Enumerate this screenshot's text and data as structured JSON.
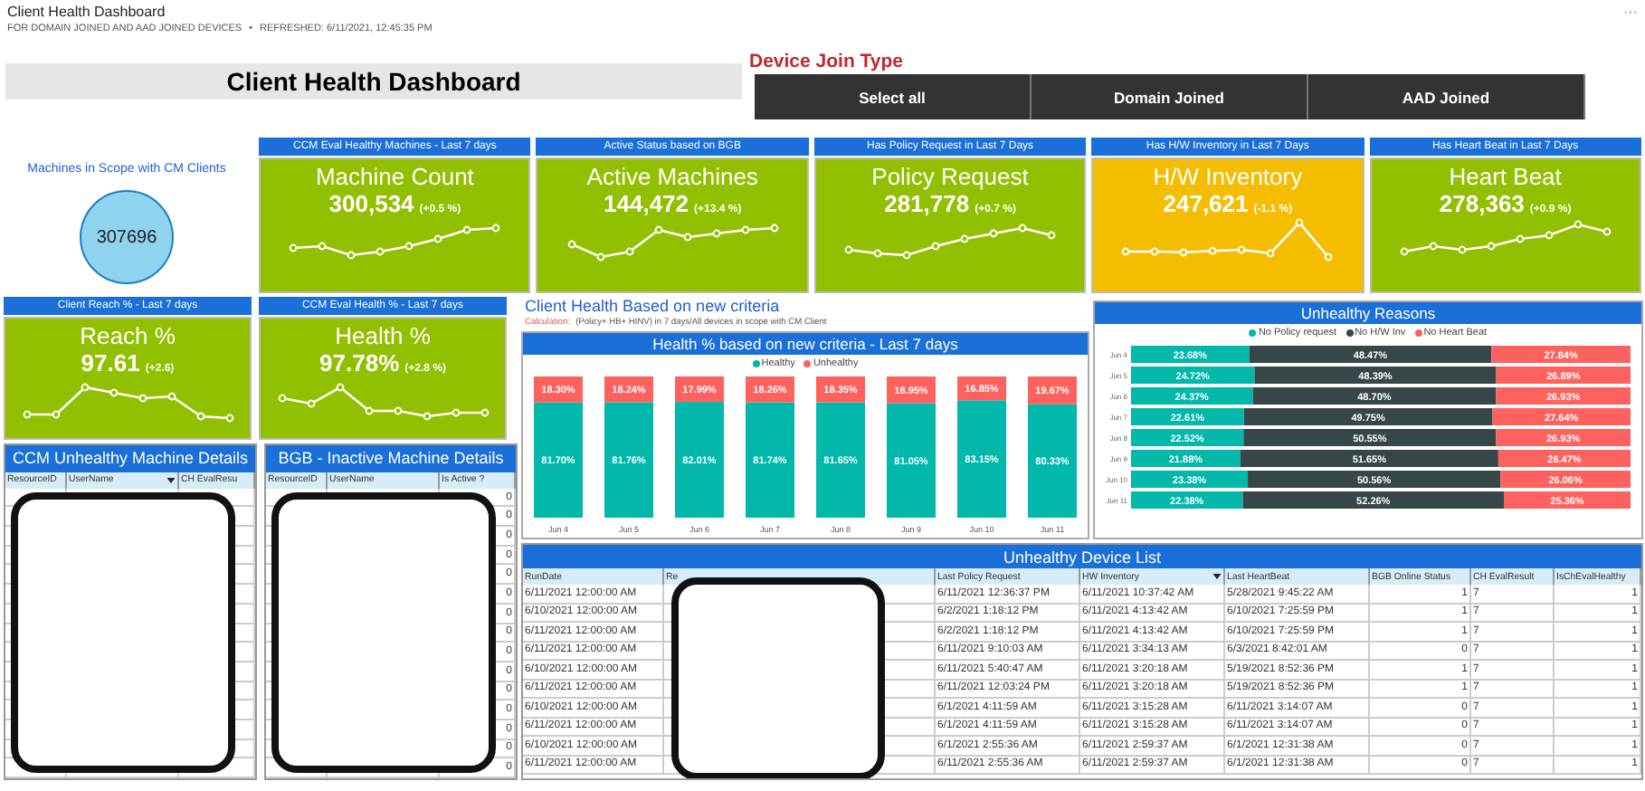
{
  "header": {
    "title": "Client Health Dashboard",
    "subtitle": "FOR DOMAIN JOINED AND AAD JOINED DEVICES",
    "separator": "•",
    "refreshed": "REFRESHED: 6/11/2021, 12:45:35 PM",
    "more": "···"
  },
  "banner": {
    "title": "Client Health Dashboard"
  },
  "join_type": {
    "label": "Device Join Type",
    "buttons": [
      {
        "label": "Select all",
        "selected": false
      },
      {
        "label": "Domain Joined",
        "selected": false
      },
      {
        "label": "AAD Joined",
        "selected": false
      }
    ]
  },
  "scope": {
    "label": "Machines in Scope with CM Clients",
    "count": "307696"
  },
  "kpi_cards": [
    {
      "header": "CCM Eval Healthy Machines - Last 7 days",
      "title": "Machine Count",
      "value": "300,534",
      "delta": "(+0.5 %)",
      "color": "#92c000"
    },
    {
      "header": "Active Status based on BGB",
      "title": "Active Machines",
      "value": "144,472",
      "delta": "(+13.4 %)",
      "color": "#92c000"
    },
    {
      "header": "Has Policy Request in Last 7 Days",
      "title": "Policy Request",
      "value": "281,778",
      "delta": "(+0.7 %)",
      "color": "#92c000"
    },
    {
      "header": "Has H/W Inventory in Last 7 Days",
      "title": "H/W Inventory",
      "value": "247,621",
      "delta": "(-1.1 %)",
      "color": "#f5bd00"
    },
    {
      "header": "Has Heart Beat in Last 7 Days",
      "title": "Heart Beat",
      "value": "278,363",
      "delta": "(+0.9 %)",
      "color": "#92c000"
    }
  ],
  "small_cards": [
    {
      "header": "Client Reach %  - Last 7 days",
      "title": "Reach %",
      "value": "97.61",
      "delta": "(+2.6)",
      "color": "#92c000"
    },
    {
      "header": "CCM Eval Health %  - Last 7 days",
      "title": "Health %",
      "value": "97.78%",
      "delta": "(+2.8 %)",
      "color": "#92c000"
    }
  ],
  "criteria": {
    "title": "Client Health Based on new criteria",
    "calc_label": "Calculation:",
    "calc_text": "(Policy+ HB+ HINV) in 7 days/All devices in scope with CM Client",
    "chart_data": {
      "type": "bar",
      "title": "Health % based on new criteria - Last 7 days",
      "stacked": true,
      "data_labels": true,
      "categories": [
        "Jun 4",
        "Jun 5",
        "Jun 6",
        "Jun 7",
        "Jun 8",
        "Jun 9",
        "Jun 10",
        "Jun 11"
      ],
      "series": [
        {
          "name": "Healthy",
          "color": "#01b8aa",
          "values": [
            81.7,
            81.76,
            82.01,
            81.74,
            81.65,
            81.05,
            83.15,
            80.33
          ],
          "value_labels": [
            "81.70%",
            "81.76%",
            "82.01%",
            "81.74%",
            "81.65%",
            "81.05%",
            "83.15%",
            "80.33%"
          ]
        },
        {
          "name": "Unhealthy",
          "color": "#fd625e",
          "values": [
            18.3,
            18.24,
            17.99,
            18.26,
            18.35,
            18.95,
            16.85,
            19.67
          ],
          "value_labels": [
            "18.30%",
            "18.24%",
            "17.99%",
            "18.26%",
            "18.35%",
            "18.95%",
            "16.85%",
            "19.67%"
          ]
        }
      ]
    }
  },
  "reasons": {
    "chart_data": {
      "type": "bar",
      "orientation": "horizontal",
      "title": "Unhealthy Reasons",
      "stacked": true,
      "data_labels": true,
      "xlim": [
        0,
        100
      ],
      "categories": [
        "Jun 4",
        "Jun 5",
        "Jun 6",
        "Jun 7",
        "Jun 8",
        "Jun 9",
        "Jun 10",
        "Jun 11"
      ],
      "series": [
        {
          "name": "No Policy request",
          "color": "#01b8aa",
          "values": [
            23.68,
            24.72,
            24.37,
            22.61,
            22.52,
            21.88,
            23.38,
            22.38
          ],
          "value_labels": [
            "23.68%",
            "24.72%",
            "24.37%",
            "22.61%",
            "22.52%",
            "21.88%",
            "23.38%",
            "22.38%"
          ]
        },
        {
          "name": "No H/W Inv",
          "color": "#374649",
          "values": [
            48.47,
            48.39,
            48.7,
            49.75,
            50.55,
            51.65,
            50.56,
            52.26
          ],
          "value_labels": [
            "48.47%",
            "48.39%",
            "48.70%",
            "49.75%",
            "50.55%",
            "51.65%",
            "50.56%",
            "52.26%"
          ]
        },
        {
          "name": "No Heart Beat",
          "color": "#fd625e",
          "values": [
            27.84,
            26.89,
            26.93,
            27.64,
            26.93,
            26.47,
            26.06,
            25.36
          ],
          "value_labels": [
            "27.84%",
            "26.89%",
            "26.93%",
            "27.64%",
            "26.93%",
            "26.47%",
            "26.06%",
            "25.36%"
          ]
        }
      ]
    }
  },
  "ccm_table": {
    "title": "CCM Unhealthy Machine Details",
    "redacted": true,
    "columns": [
      {
        "label": "ResourceID",
        "sorted": false
      },
      {
        "label": "UserName",
        "sorted": true
      },
      {
        "label": "CH EvalResu",
        "sorted": false
      }
    ],
    "rows": [
      [],
      [],
      [],
      [],
      [],
      [],
      [],
      [],
      [],
      [],
      [],
      [],
      [],
      [],
      []
    ]
  },
  "bgb_table": {
    "title": "BGB - Inactive Machine Details",
    "redacted": true,
    "columns": [
      {
        "label": "ResourceID",
        "sorted": false
      },
      {
        "label": "UserName",
        "sorted": false
      },
      {
        "label": "Is Active ?",
        "sorted": false
      }
    ],
    "rows": [
      [
        "0"
      ],
      [
        "0"
      ],
      [
        "0"
      ],
      [
        "0"
      ],
      [
        "0"
      ],
      [
        "0"
      ],
      [
        "0"
      ],
      [
        "0"
      ],
      [
        "0"
      ],
      [
        "0"
      ],
      [
        "0"
      ],
      [
        "0"
      ],
      [
        "0"
      ],
      [
        "0"
      ],
      [
        "0"
      ]
    ]
  },
  "device_list": {
    "title": "Unhealthy Device List",
    "redacted": true,
    "columns": [
      {
        "label": "RunDate",
        "sorted": false
      },
      {
        "label": "Re",
        "sorted": false
      },
      {
        "label": "Last Policy Request",
        "sorted": false
      },
      {
        "label": "HW Inventory",
        "sorted": true
      },
      {
        "label": "Last HeartBeat",
        "sorted": false
      },
      {
        "label": "BGB Online Status",
        "sorted": false
      },
      {
        "label": "CH EvalResult",
        "sorted": false
      },
      {
        "label": "IsChEvalHealthy",
        "sorted": false
      }
    ],
    "rows": [
      [
        "6/11/2021 12:00:00 AM",
        "",
        "6/11/2021 12:36:37 PM",
        "6/11/2021 10:37:42 AM",
        "5/28/2021 9:45:22 AM",
        "1",
        "7",
        "1"
      ],
      [
        "6/10/2021 12:00:00 AM",
        "",
        "6/2/2021 1:18:12 PM",
        "6/11/2021 4:13:42 AM",
        "6/10/2021 7:25:59 PM",
        "1",
        "7",
        "1"
      ],
      [
        "6/11/2021 12:00:00 AM",
        "",
        "6/2/2021 1:18:12 PM",
        "6/11/2021 4:13:42 AM",
        "6/10/2021 7:25:59 PM",
        "1",
        "7",
        "1"
      ],
      [
        "6/11/2021 12:00:00 AM",
        "",
        "6/11/2021 9:10:03 AM",
        "6/11/2021 3:34:13 AM",
        "6/3/2021 8:42:01 AM",
        "0",
        "7",
        "1"
      ],
      [
        "6/10/2021 12:00:00 AM",
        "",
        "6/11/2021 5:40:47 AM",
        "6/11/2021 3:20:18 AM",
        "5/19/2021 8:52:36 PM",
        "1",
        "7",
        "1"
      ],
      [
        "6/11/2021 12:00:00 AM",
        "",
        "6/11/2021 12:03:24 PM",
        "6/11/2021 3:20:18 AM",
        "5/19/2021 8:52:36 PM",
        "1",
        "7",
        "1"
      ],
      [
        "6/10/2021 12:00:00 AM",
        "",
        "6/1/2021 4:11:59 AM",
        "6/11/2021 3:15:28 AM",
        "6/11/2021 3:14:07 AM",
        "0",
        "7",
        "1"
      ],
      [
        "6/11/2021 12:00:00 AM",
        "",
        "6/1/2021 4:11:59 AM",
        "6/11/2021 3:15:28 AM",
        "6/11/2021 3:14:07 AM",
        "0",
        "7",
        "1"
      ],
      [
        "6/10/2021 12:00:00 AM",
        "",
        "6/1/2021 2:55:36 AM",
        "6/11/2021 2:59:37 AM",
        "6/1/2021 12:31:38 AM",
        "0",
        "7",
        "1"
      ],
      [
        "6/11/2021 12:00:00 AM",
        "",
        "6/11/2021 2:55:36 AM",
        "6/11/2021 2:59:37 AM",
        "6/1/2021 12:31:38 AM",
        "0",
        "7",
        "1"
      ]
    ]
  }
}
